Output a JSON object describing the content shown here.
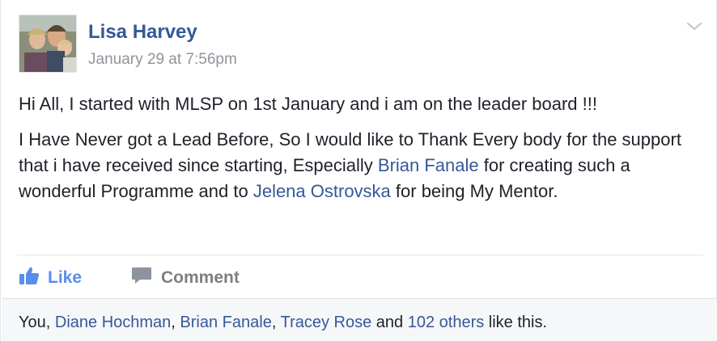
{
  "post": {
    "author": "Lisa Harvey",
    "timestamp": "January 29 at 7:56pm",
    "paragraph1": "Hi All, I started with MLSP on 1st January and i am on the leader board !!!",
    "paragraph2": {
      "part1": "I Have Never got a Lead Before, So I would like to Thank Every body for the support that i have received since starting, Especially ",
      "mention1": "Brian Fanale",
      "part2": " for creating such a wonderful Programme and to ",
      "mention2": "Jelena Ostrovska",
      "part3": " for being My Mentor."
    }
  },
  "actions": {
    "like_label": "Like",
    "comment_label": "Comment"
  },
  "likes": {
    "prefix": "You, ",
    "names": [
      "Diane Hochman",
      "Brian Fanale",
      "Tracey Rose"
    ],
    "sep": ", ",
    "and_text": " and ",
    "others_link": "102 others",
    "suffix": " like this."
  },
  "icons": {
    "options": "chevron-down-icon",
    "like": "thumbs-up-icon",
    "comment": "speech-bubble-icon"
  },
  "colors": {
    "link": "#365899",
    "like_active": "#598cf0",
    "meta_gray": "#90949c",
    "text": "#1d2129"
  }
}
